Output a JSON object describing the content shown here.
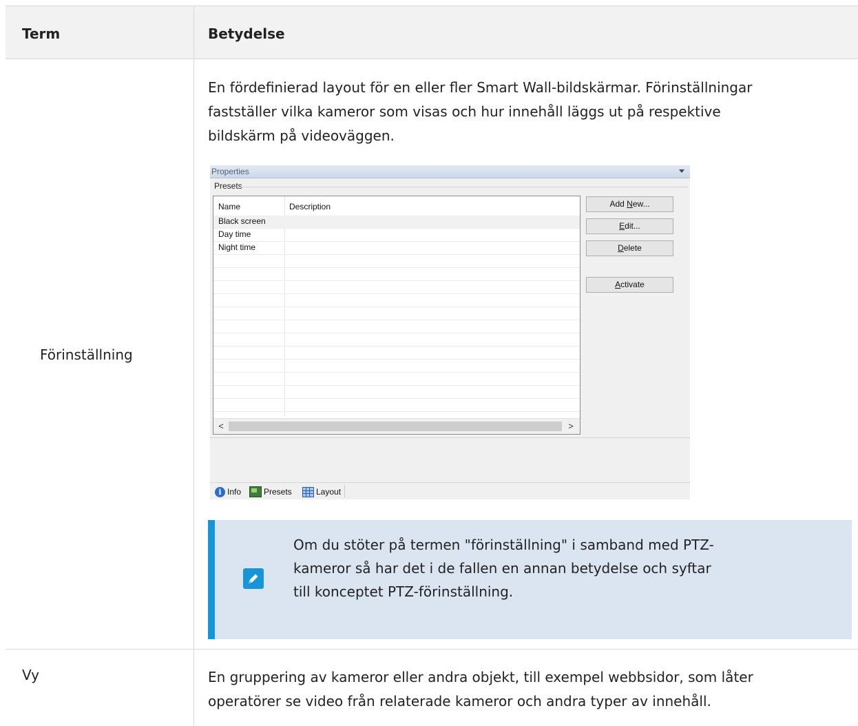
{
  "table": {
    "header": {
      "term": "Term",
      "meaning": "Betydelse"
    },
    "rows": [
      {
        "term": "Förinställning",
        "definition_lines": [
          "En fördefinierad layout för en eller fler Smart Wall-bildskärmar. Förinställningar",
          "fastställer vilka kameror som visas och hur innehåll läggs ut på respektive",
          "bildskärm på videoväggen."
        ],
        "note_lines": [
          "Om du stöter på termen \"förinställning\" i samband med PTZ-",
          "kameror så har det i de fallen en annan betydelse och syftar",
          "till konceptet PTZ-förinställning."
        ]
      },
      {
        "term": "Vy",
        "definition_lines": [
          "En gruppering av kameror eller andra objekt, till exempel webbsidor, som låter",
          "operatörer se video från relaterade kameror och andra typer av innehåll."
        ]
      }
    ]
  },
  "screenshot": {
    "panel_title": "Properties",
    "group_label": "Presets",
    "columns": [
      "Name",
      "Description"
    ],
    "presets": [
      "Black screen",
      "Day time",
      "Night time"
    ],
    "buttons": {
      "add_new": {
        "pre": "Add ",
        "accel": "N",
        "post": "ew..."
      },
      "edit": {
        "pre": "",
        "accel": "E",
        "post": "dit..."
      },
      "delete": {
        "pre": "",
        "accel": "D",
        "post": "elete"
      },
      "activate": {
        "pre": "",
        "accel": "A",
        "post": "ctivate"
      }
    },
    "scroll_left": "<",
    "scroll_right": ">",
    "tabs": {
      "info": "Info",
      "presets": "Presets",
      "layout": "Layout"
    }
  },
  "colors": {
    "note_bg": "#dbe5f2",
    "note_accent": "#1795d6",
    "header_bg": "#f2f2f2"
  },
  "icons": {
    "note": "pencil-icon",
    "info": "info-icon",
    "presets": "presets-icon",
    "layout": "layout-grid-icon"
  }
}
